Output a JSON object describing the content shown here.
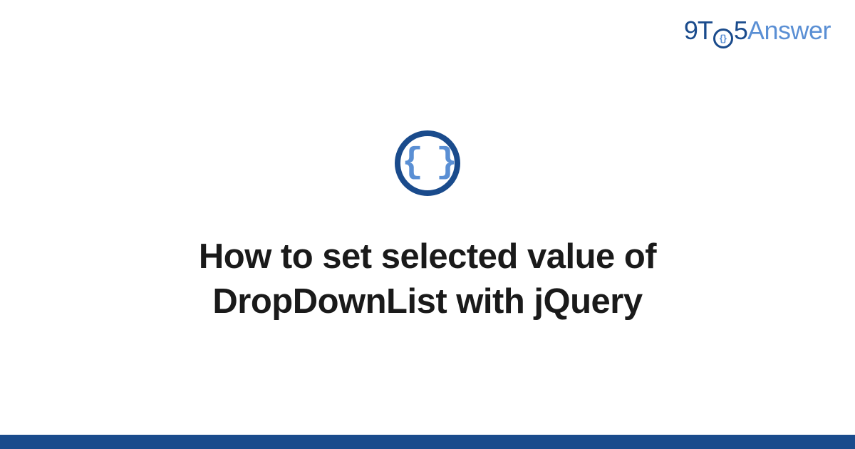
{
  "brand": {
    "part1": "9T",
    "o_inner": "{}",
    "part2": "5",
    "part3": "Answer"
  },
  "icon": {
    "name": "code-braces-icon",
    "glyph": "{ }"
  },
  "title": "How to set selected value of DropDownList with jQuery",
  "colors": {
    "brand_dark": "#1a4b8c",
    "brand_light": "#5a8fd4"
  }
}
